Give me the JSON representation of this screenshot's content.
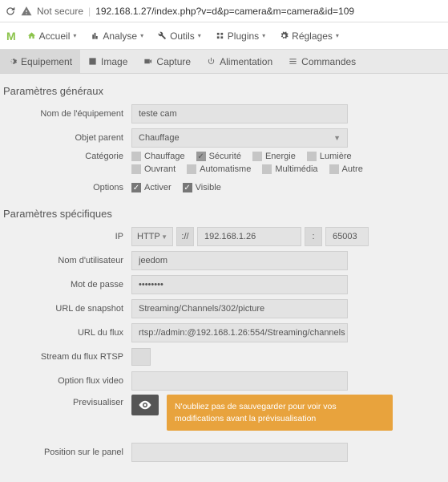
{
  "browser": {
    "not_secure_label": "Not secure",
    "url": "192.168.1.27/index.php?v=d&p=camera&m=camera&id=109"
  },
  "top_menu": {
    "accueil": "Accueil",
    "analyse": "Analyse",
    "outils": "Outils",
    "plugins": "Plugins",
    "reglages": "Réglages"
  },
  "tabs": {
    "equipement": "Equipement",
    "image": "Image",
    "capture": "Capture",
    "alimentation": "Alimentation",
    "commandes": "Commandes"
  },
  "sections": {
    "general": "Paramètres généraux",
    "specific": "Paramètres spécifiques"
  },
  "general": {
    "name_label": "Nom de l'équipement",
    "name_value": "teste cam",
    "parent_label": "Objet parent",
    "parent_value": "Chauffage",
    "category_label": "Catégorie",
    "options_label": "Options",
    "cat": {
      "chauffage": "Chauffage",
      "securite": "Sécurité",
      "energie": "Energie",
      "lumiere": "Lumière",
      "ouvrant": "Ouvrant",
      "automatisme": "Automatisme",
      "multimedia": "Multimédia",
      "autre": "Autre"
    },
    "opt_activer": "Activer",
    "opt_visible": "Visible"
  },
  "specific": {
    "ip_label": "IP",
    "ip_proto": "HTTP",
    "ip_sep1": "://",
    "ip_host": "192.168.1.26",
    "ip_sep2": ":",
    "ip_port": "65003",
    "user_label": "Nom d'utilisateur",
    "user_value": "jeedom",
    "pass_label": "Mot de passe",
    "pass_value": "••••••••",
    "snap_label": "URL de snapshot",
    "snap_value": "Streaming/Channels/302/picture",
    "flux_label": "URL du flux",
    "flux_prefix": "rtsp://admin:",
    "flux_suffix": "@192.168.1.26:554/Streaming/channels",
    "rtsp_label": "Stream du flux RTSP",
    "video_opt_label": "Option flux video",
    "video_opt_value": "",
    "preview_label": "Previsualiser",
    "preview_warning": "N'oubliez pas de sauvegarder pour voir vos modifications avant la prévisualisation",
    "panel_pos_label": "Position sur le panel"
  }
}
